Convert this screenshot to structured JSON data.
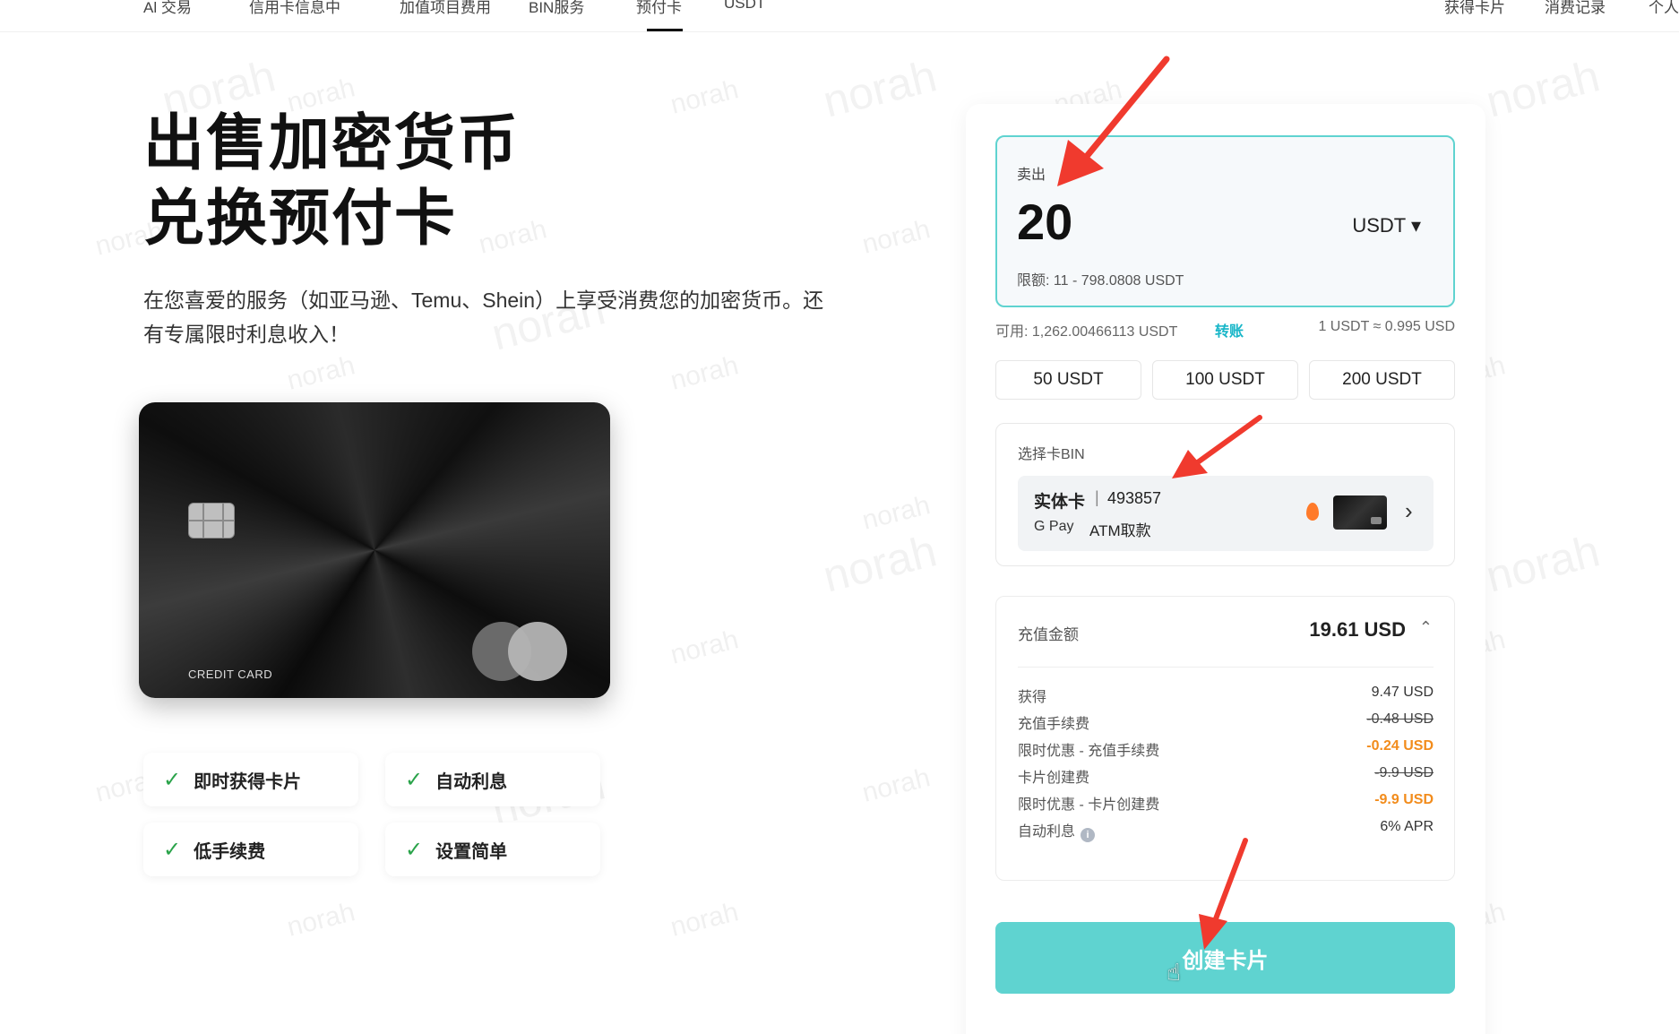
{
  "nav": {
    "left_items": [
      "Al 交易",
      "信用卡信息中",
      "加值项目费用",
      "BIN服务",
      "预付卡",
      "USDT"
    ],
    "right_items": [
      "获得卡片",
      "消费记录",
      "个人"
    ]
  },
  "watermark": "norah",
  "hero": {
    "title_line1": "出售加密货币",
    "title_line2": "兑换预付卡",
    "description": "在您喜爱的服务（如亚马逊、Temu、Shein）上享受消费您的加密货币。还有专属限时利息收入！"
  },
  "card_image": {
    "label": "CREDIT CARD"
  },
  "features": [
    "即时获得卡片",
    "自动利息",
    "低手续费",
    "设置简单"
  ],
  "sell": {
    "label": "卖出",
    "amount": "20",
    "currency": "USDT ▾",
    "limit": "限额: 11 - 798.0808 USDT"
  },
  "balance": {
    "available": "可用: 1,262.00466113 USDT",
    "transfer": "转账",
    "rate": "1 USDT ≈ 0.995 USD"
  },
  "presets": [
    "50 USDT",
    "100 USDT",
    "200 USDT"
  ],
  "bin": {
    "label": "选择卡BIN",
    "card_type": "实体卡",
    "separator": "|",
    "bin_number": "493857",
    "gpay": "G Pay",
    "atm": "ATM取款"
  },
  "summary": {
    "label": "充值金额",
    "value": "19.61 USD",
    "rows": [
      {
        "key": "获得",
        "value": "9.47 USD"
      },
      {
        "key": "充值手续费",
        "value": "-0.48 USD"
      },
      {
        "key": "限时优惠 - 充值手续费",
        "value": "-0.24 USD"
      },
      {
        "key": "卡片创建费",
        "value": "-9.9 USD"
      },
      {
        "key": "限时优惠 - 卡片创建费",
        "value": "-9.9 USD"
      },
      {
        "key": "自动利息",
        "value": "6% APR"
      }
    ]
  },
  "create_button": "创建卡片",
  "colors": {
    "accent": "#5fd3d0",
    "promo": "#f28c1c",
    "link": "#18b6c8",
    "check": "#2aa34a",
    "arrow": "#f03a2e"
  }
}
